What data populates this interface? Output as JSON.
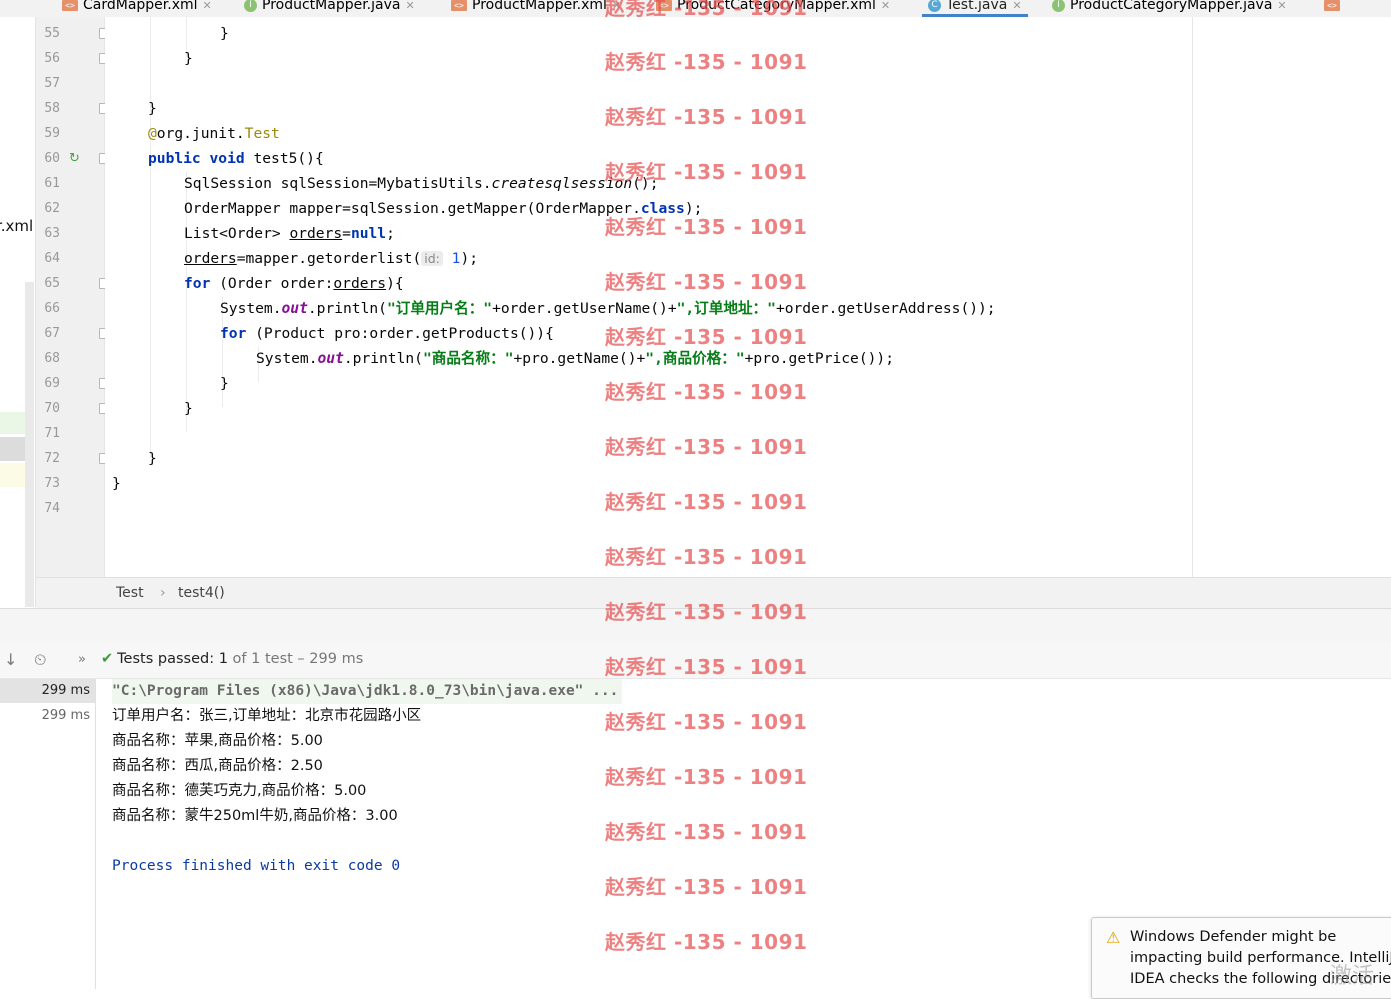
{
  "tabs": [
    {
      "label": "CardMapper.xml",
      "icon": "xml-file-icon"
    },
    {
      "label": "ProductMapper.java",
      "icon": "interface-file-icon"
    },
    {
      "label": "ProductMapper.xml",
      "icon": "xml-file-icon"
    },
    {
      "label": "ProductCategoryMapper.xml",
      "icon": "xml-file-icon"
    },
    {
      "label": "Test.java",
      "icon": "class-file-icon",
      "active": true
    },
    {
      "label": "ProductCategoryMapper.java",
      "icon": "interface-file-icon"
    }
  ],
  "project_sidebar": {
    "visible_fragment": "r.xml"
  },
  "editor": {
    "line_numbers": [
      "55",
      "56",
      "57",
      "58",
      "59",
      "60",
      "61",
      "62",
      "63",
      "64",
      "65",
      "66",
      "67",
      "68",
      "69",
      "70",
      "71",
      "72",
      "73",
      "74"
    ],
    "code": {
      "l55": "}",
      "l56": "}",
      "l58": "}",
      "l59_at": "@",
      "l59_pkg": "org.junit.",
      "l59_ann": "Test",
      "l60_kw1": "public",
      "l60_kw2": "void",
      "l60_rest": " test5(){",
      "l61_a": "SqlSession sqlSession=MybatisUtils.",
      "l61_b": "createsqlsession",
      "l61_c": "();",
      "l62_a": "OrderMapper mapper=sqlSession.getMapper(OrderMapper.",
      "l62_kw": "class",
      "l62_c": ");",
      "l63_a": "List<Order> ",
      "l63_var": "orders",
      "l63_b": "=",
      "l63_null": "null",
      "l63_c": ";",
      "l64_var": "orders",
      "l64_a": "=mapper.getorderlist(",
      "l64_hint": "id:",
      "l64_num": "1",
      "l64_c": ");",
      "l65_kw": "for",
      "l65_a": " (Order order:",
      "l65_var": "orders",
      "l65_c": "){",
      "l66_a": "System.",
      "l66_out": "out",
      "l66_b": ".println(",
      "l66_s1": "\"订单用户名：\"",
      "l66_c": "+order.getUserName()+",
      "l66_s2": "\",订单地址：\"",
      "l66_d": "+order.getUserAddress());",
      "l67_kw": "for",
      "l67_a": " (Product pro:order.getProducts()){",
      "l68_a": "System.",
      "l68_out": "out",
      "l68_b": ".println(",
      "l68_s1": "\"商品名称：\"",
      "l68_c": "+pro.getName()+",
      "l68_s2": "\",商品价格：\"",
      "l68_d": "+pro.getPrice());",
      "l69": "}",
      "l70": "}",
      "l72": "}",
      "l73": "}"
    }
  },
  "breadcrumb": {
    "items": [
      "Test",
      "test4()"
    ],
    "separator": "›"
  },
  "run_panel": {
    "status_prefix": "Tests passed:",
    "status_count": "1",
    "status_suffix": "of 1 test – 299 ms",
    "tree": [
      "299 ms",
      "299 ms"
    ],
    "console": [
      "\"C:\\Program Files (x86)\\Java\\jdk1.8.0_73\\bin\\java.exe\" ...",
      "订单用户名：张三,订单地址：北京市花园路小区",
      "商品名称：苹果,商品价格：5.00",
      "商品名称：西瓜,商品价格：2.50",
      "商品名称：德芙巧克力,商品价格：5.00",
      "商品名称：蒙牛250ml牛奶,商品价格：3.00",
      "",
      "Process finished with exit code 0"
    ]
  },
  "watermark": "赵秀红 -135 - 1091",
  "notification": {
    "text": "Windows Defender might be impacting build performance. IntelliJ IDEA checks the following directories:"
  },
  "activate_overlay": "激活"
}
